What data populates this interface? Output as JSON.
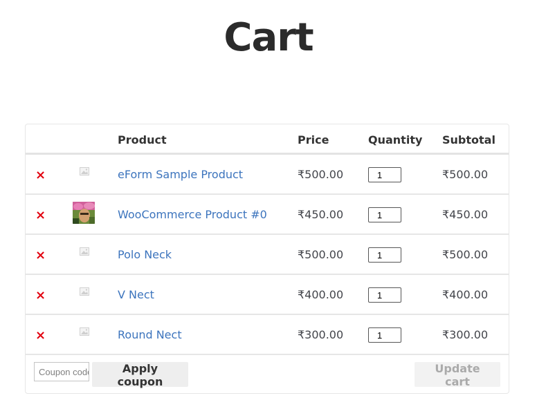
{
  "page": {
    "title": "Cart"
  },
  "cart": {
    "columns": {
      "product": "Product",
      "price": "Price",
      "quantity": "Quantity",
      "subtotal": "Subtotal"
    },
    "remove_symbol": "×",
    "items": [
      {
        "name": "eForm Sample Product",
        "price": "₹500.00",
        "quantity": "1",
        "subtotal": "₹500.00",
        "thumbnail": "placeholder-image-icon"
      },
      {
        "name": "WooCommerce Product #0",
        "price": "₹450.00",
        "quantity": "1",
        "subtotal": "₹450.00",
        "thumbnail": "product-photo"
      },
      {
        "name": "Polo Neck",
        "price": "₹500.00",
        "quantity": "1",
        "subtotal": "₹500.00",
        "thumbnail": "placeholder-image-icon"
      },
      {
        "name": "V Nect",
        "price": "₹400.00",
        "quantity": "1",
        "subtotal": "₹400.00",
        "thumbnail": "placeholder-image-icon"
      },
      {
        "name": "Round Nect",
        "price": "₹300.00",
        "quantity": "1",
        "subtotal": "₹300.00",
        "thumbnail": "placeholder-image-icon"
      }
    ],
    "actions": {
      "coupon_placeholder": "Coupon code",
      "apply_coupon_label": "Apply coupon",
      "update_cart_label": "Update cart"
    }
  },
  "colors": {
    "link": "#3c74bd",
    "remove": "#e2000f",
    "text": "#43454b",
    "update_disabled_text": "#aaaaaa"
  }
}
